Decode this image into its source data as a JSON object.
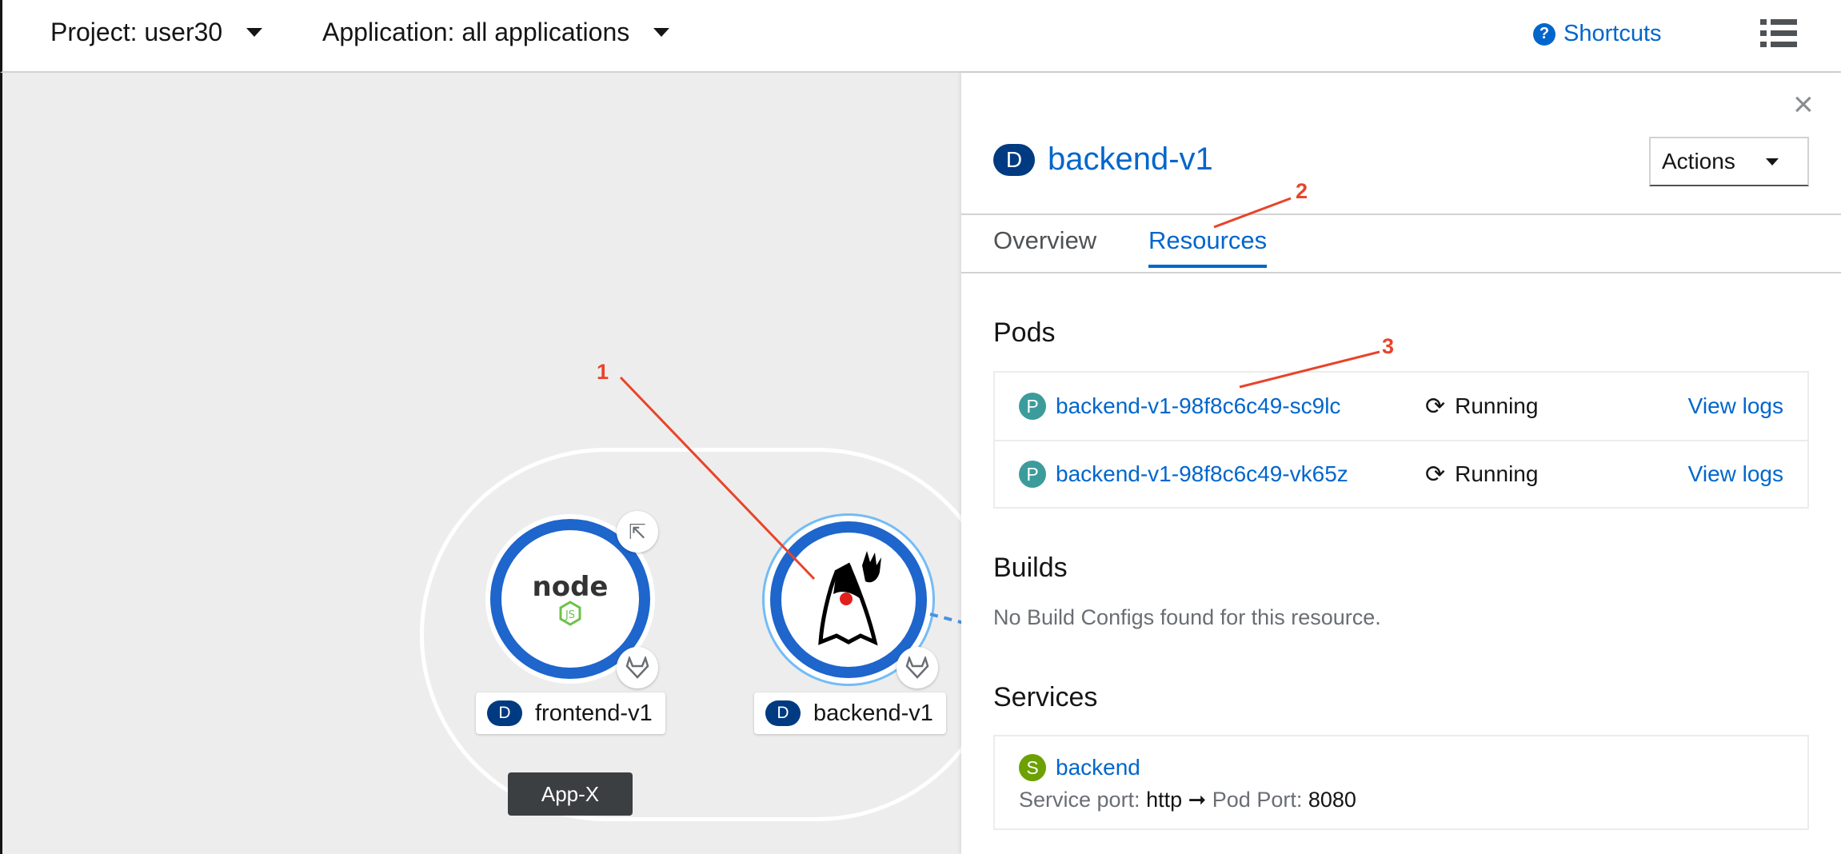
{
  "topbar": {
    "project_label": "Project: user30",
    "application_label": "Application: all applications",
    "shortcuts_label": "Shortcuts"
  },
  "topology": {
    "group_label": "App-X",
    "nodes": [
      {
        "badge": "D",
        "label": "frontend-v1",
        "runtime_icon": "nodejs-icon"
      },
      {
        "badge": "D",
        "label": "backend-v1",
        "runtime_icon": "java-duke-icon"
      }
    ]
  },
  "panel": {
    "badge": "D",
    "title": "backend-v1",
    "actions_label": "Actions",
    "tabs": [
      {
        "label": "Overview",
        "active": false
      },
      {
        "label": "Resources",
        "active": true
      }
    ],
    "pods": {
      "heading": "Pods",
      "items": [
        {
          "badge": "P",
          "name": "backend-v1-98f8c6c49-sc9lc",
          "status": "Running",
          "action": "View logs"
        },
        {
          "badge": "P",
          "name": "backend-v1-98f8c6c49-vk65z",
          "status": "Running",
          "action": "View logs"
        }
      ]
    },
    "builds": {
      "heading": "Builds",
      "empty_text": "No Build Configs found for this resource."
    },
    "services": {
      "heading": "Services",
      "items": [
        {
          "badge": "S",
          "name": "backend",
          "service_port_label": "Service port:",
          "service_port": "http",
          "arrow": "➞",
          "pod_port_label": "Pod Port:",
          "pod_port": "8080"
        }
      ]
    }
  },
  "annotations": [
    "1",
    "2",
    "3"
  ],
  "colors": {
    "link": "#0066cc",
    "annotation": "#e8442b",
    "deployment_badge": "#003a80",
    "pod_badge": "#3c9c9c",
    "service_badge": "#6ca100",
    "node_ring": "#1e65cc"
  }
}
